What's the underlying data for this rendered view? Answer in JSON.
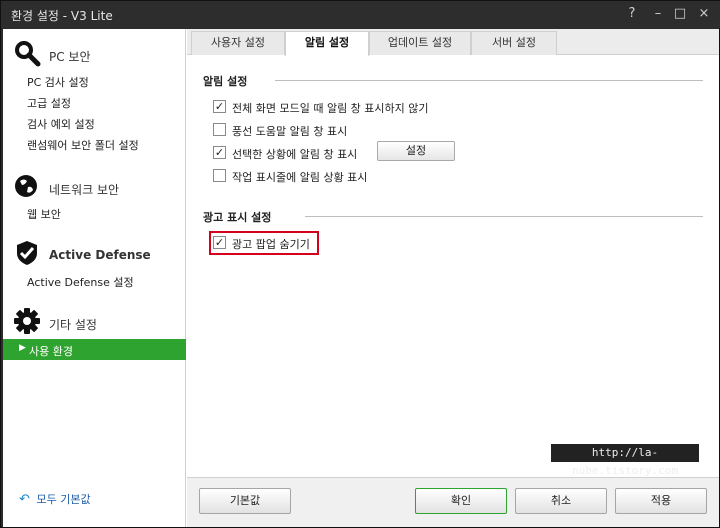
{
  "window": {
    "title": "환경 설정 - V3 Lite",
    "help": "?",
    "minimize": "–",
    "maximize": "□",
    "close": "×"
  },
  "sidebar": {
    "sections": [
      {
        "icon": "magnifier-icon",
        "label": "PC 보안",
        "items": [
          "PC 검사 설정",
          "고급 설정",
          "검사 예외 설정",
          "랜섬웨어 보안 폴더 설정"
        ]
      },
      {
        "icon": "globe-icon",
        "label": "네트워크 보안",
        "items": [
          "웹 보안"
        ]
      },
      {
        "icon": "shield-check-icon",
        "label": "Active Defense",
        "items": [
          "Active Defense 설정"
        ]
      },
      {
        "icon": "gear-icon",
        "label": "기타 설정",
        "items": [
          "사용 환경"
        ]
      }
    ],
    "selected_item": "사용 환경",
    "reset_all": "모두 기본값"
  },
  "tabs": [
    "사용자 설정",
    "알림 설정",
    "업데이트 설정",
    "서버 설정"
  ],
  "active_tab": "알림 설정",
  "alert_group": {
    "title": "알림 설정",
    "options": [
      {
        "label": "전체 화면 모드일 때 알림 창 표시하지 않기",
        "checked": true
      },
      {
        "label": "풍선 도움말 알림 창 표시",
        "checked": false
      },
      {
        "label": "선택한 상황에 알림 창 표시",
        "checked": true
      },
      {
        "label": "작업 표시줄에 알림 상황 표시",
        "checked": false
      }
    ],
    "settings_button": "설정"
  },
  "ad_group": {
    "title": "광고 표시 설정",
    "options": [
      {
        "label": "광고 팝업 숨기기",
        "checked": true
      }
    ]
  },
  "footer": {
    "default": "기본값",
    "ok": "확인",
    "cancel": "취소",
    "apply": "적용"
  },
  "watermark": "http://la-nube.tistory.com",
  "colors": {
    "accent": "#2fa32f",
    "highlight": "#d6001c",
    "titlebar": "#2d2d2d"
  }
}
